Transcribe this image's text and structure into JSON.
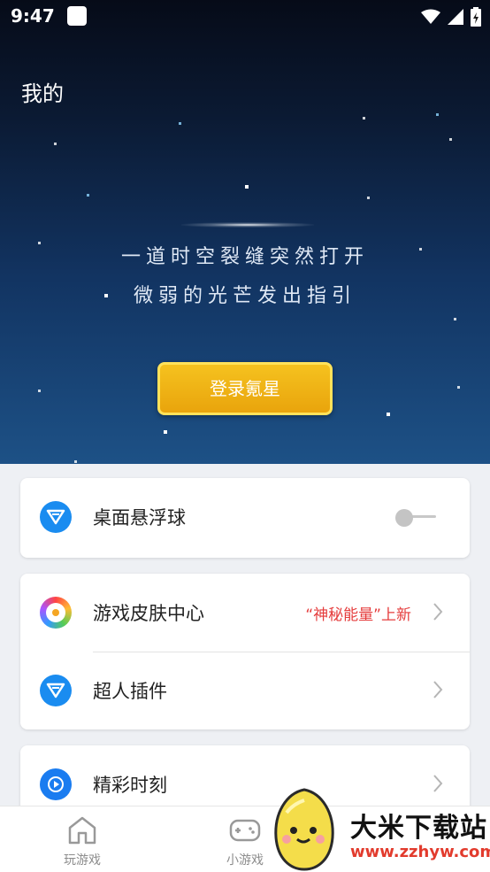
{
  "status": {
    "time": "9:47"
  },
  "header": {
    "title": "我的"
  },
  "hero": {
    "line1": "一道时空裂缝突然打开",
    "line2": "微弱的光芒发出指引",
    "login_label": "登录氪星"
  },
  "settings": {
    "floating_ball": {
      "label": "桌面悬浮球",
      "enabled": false
    },
    "skin_center": {
      "label": "游戏皮肤中心",
      "badge": "“神秘能量”上新"
    },
    "superman_plugin": {
      "label": "超人插件"
    },
    "highlights": {
      "label": "精彩时刻"
    }
  },
  "tabs": [
    {
      "label": "玩游戏",
      "icon": "home-icon"
    },
    {
      "label": "小游戏",
      "icon": "gamepad-icon"
    }
  ],
  "watermark": {
    "title": "大米下载站",
    "url": "www.zzhyw.com"
  },
  "colors": {
    "accent_red": "#e53c3c",
    "login_gold": "#f5c21f",
    "plugin_blue": "#1a8cf0"
  }
}
